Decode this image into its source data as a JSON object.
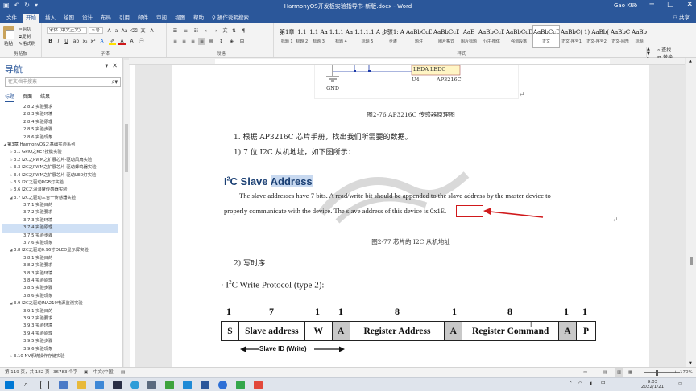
{
  "window": {
    "title": "HarmonyOS开发板实验指导书-新版.docx - Word",
    "user": "Gao Kuo",
    "share": "共享"
  },
  "ribbon_tabs": [
    "文件",
    "开始",
    "插入",
    "绘图",
    "设计",
    "布局",
    "引用",
    "邮件",
    "审阅",
    "视图",
    "帮助",
    "操作说明搜索"
  ],
  "clipboard": {
    "paste": "粘贴",
    "cut": "剪切",
    "copy": "复制",
    "format_painter": "格式刷",
    "label": "剪贴板"
  },
  "font": {
    "name": "宋体 (中文正文)",
    "size": "五号",
    "label": "字体"
  },
  "paragraph": {
    "label": "段落"
  },
  "styles": {
    "label": "样式",
    "items": [
      {
        "sample": "第1章",
        "name": "标题 1"
      },
      {
        "sample": "1.1",
        "name": "标题 2"
      },
      {
        "sample": "1.1 Aa",
        "name": "标题 3"
      },
      {
        "sample": "1.1.1 Aa",
        "name": "标题 4"
      },
      {
        "sample": "1.1.1.1 A",
        "name": "标题 5"
      },
      {
        "sample": "步骤1: A",
        "name": "步骤"
      },
      {
        "sample": "AaBbCcDd",
        "name": "题注"
      },
      {
        "sample": "AaBbCcDd",
        "name": "图片格式"
      },
      {
        "sample": "AaE",
        "name": "图片标题"
      },
      {
        "sample": "AaBbCcDdl",
        "name": "小注-楷体"
      },
      {
        "sample": "AaBbCcDd",
        "name": "强调段落"
      },
      {
        "sample": "AaBbCcDd",
        "name": "正文"
      },
      {
        "sample": "AaBbC(",
        "name": "正文-序号1"
      },
      {
        "sample": "1) AaBb(",
        "name": "正文-序号2"
      },
      {
        "sample": "AaBbC",
        "name": "正文-图形"
      },
      {
        "sample": "AaBb",
        "name": "标题"
      }
    ]
  },
  "editing": {
    "find": "查找",
    "replace": "替换",
    "select": "选择",
    "label": "编辑"
  },
  "nav": {
    "title": "导航",
    "search_placeholder": "在文档中搜索",
    "tabs": [
      "标题",
      "页面",
      "结果"
    ],
    "items": [
      {
        "text": "2.8.2 实验要求",
        "level": 3
      },
      {
        "text": "2.8.3 实验环境",
        "level": 3
      },
      {
        "text": "2.8.4 实验原理",
        "level": 3
      },
      {
        "text": "2.8.5 实验步骤",
        "level": 3
      },
      {
        "text": "2.8.6 实验现象",
        "level": 3
      },
      {
        "text": "第3章 HarmonyOS之基础实验系列",
        "level": 1,
        "tri": "◢"
      },
      {
        "text": "3.1 GPIO之KEY按键实验",
        "level": 2,
        "tri": "▷"
      },
      {
        "text": "3.2 I2C之PWM之扩展芯片-驱动风扇实验",
        "level": 2,
        "tri": "▷"
      },
      {
        "text": "3.3 I2C之PWM之扩展芯片-驱动蜂鸣器实验",
        "level": 2,
        "tri": "▷"
      },
      {
        "text": "3.4 I2C之PWM之扩展芯片-驱动LED灯实验",
        "level": 2,
        "tri": "▷"
      },
      {
        "text": "3.5 I2C之驱动RGB灯实验",
        "level": 2,
        "tri": "▷"
      },
      {
        "text": "3.6 I2C之温湿度传感器实验",
        "level": 2,
        "tri": "▷"
      },
      {
        "text": "3.7 I2C之驱动三合一传感器实验",
        "level": 2,
        "tri": "◢"
      },
      {
        "text": "3.7.1 实验目的",
        "level": 3
      },
      {
        "text": "3.7.2 实验要求",
        "level": 3
      },
      {
        "text": "3.7.3 实验环境",
        "level": 3
      },
      {
        "text": "3.7.4 实验原理",
        "level": 3,
        "selected": true
      },
      {
        "text": "3.7.5 实验步骤",
        "level": 3
      },
      {
        "text": "3.7.6 实验现象",
        "level": 3
      },
      {
        "text": "3.8 I2C之驱动0.96寸OLED显示屏实验",
        "level": 2,
        "tri": "◢"
      },
      {
        "text": "3.8.1 实验目的",
        "level": 3
      },
      {
        "text": "3.8.2 实验要求",
        "level": 3
      },
      {
        "text": "3.8.3 实验环境",
        "level": 3
      },
      {
        "text": "3.8.4 实验原理",
        "level": 3
      },
      {
        "text": "3.8.5 实验步骤",
        "level": 3
      },
      {
        "text": "3.8.6 实验现象",
        "level": 3
      },
      {
        "text": "3.9 I2C之驱动INA219电源监测实验",
        "level": 2,
        "tri": "◢"
      },
      {
        "text": "3.9.1 实验目的",
        "level": 3
      },
      {
        "text": "3.9.2 实验要求",
        "level": 3
      },
      {
        "text": "3.9.3 实验环境",
        "level": 3
      },
      {
        "text": "3.9.4 实验原理",
        "level": 3
      },
      {
        "text": "3.9.5 实验步骤",
        "level": 3
      },
      {
        "text": "3.9.6 实验现象",
        "level": 3
      },
      {
        "text": "3.10 NV系统操作存储实验",
        "level": 2,
        "tri": "▷"
      }
    ]
  },
  "doc": {
    "circuit": {
      "chip_label": "LEDA  LEDC",
      "u_label": "U4",
      "part": "AP3216C",
      "gnd": "GND"
    },
    "fig76": "图2-76 AP3216C 传感器原理图",
    "step1": "1.  根据 AP3216C 芯片手册，找出我们所需要的数据。",
    "sub1": "1)  7 位 I2C 从机地址，如下图所示：",
    "h_i2c": "I",
    "h_sup": "2",
    "h_c": "C Slave ",
    "h_address": "Address",
    "eng1": "The slave addresses have 7 bits.   A read/write bit should be appended to the slave address by the master device to",
    "eng2a": "properly communicate with the device. The slave address of this device is ",
    "eng2b": "0x1E.",
    "fig77": "图2-77 芯片的 I2C 从机地址",
    "sub2": "2)  写时序",
    "proto_a": "· I",
    "proto_sup": "2",
    "proto_b": "C Write Protocol (type 2):",
    "bits": [
      "1",
      "7",
      "1",
      "1",
      "8",
      "1",
      "8",
      "1",
      "1"
    ],
    "fields": [
      "S",
      "Slave address",
      "W",
      "A",
      "Register Address",
      "A",
      "Register Command",
      "A",
      "P"
    ],
    "slave_id": "Slave ID (Write)",
    "pilcrow": "↵"
  },
  "status": {
    "page": "第 119 页，共 182 页",
    "words": "36783 个字",
    "lang": "中文(中国)",
    "zoom": "170%"
  },
  "tray": {
    "time": "9:03",
    "date": "2022/1/21"
  },
  "colors": {
    "accent": "#2b579a",
    "red": "#d0191b"
  }
}
